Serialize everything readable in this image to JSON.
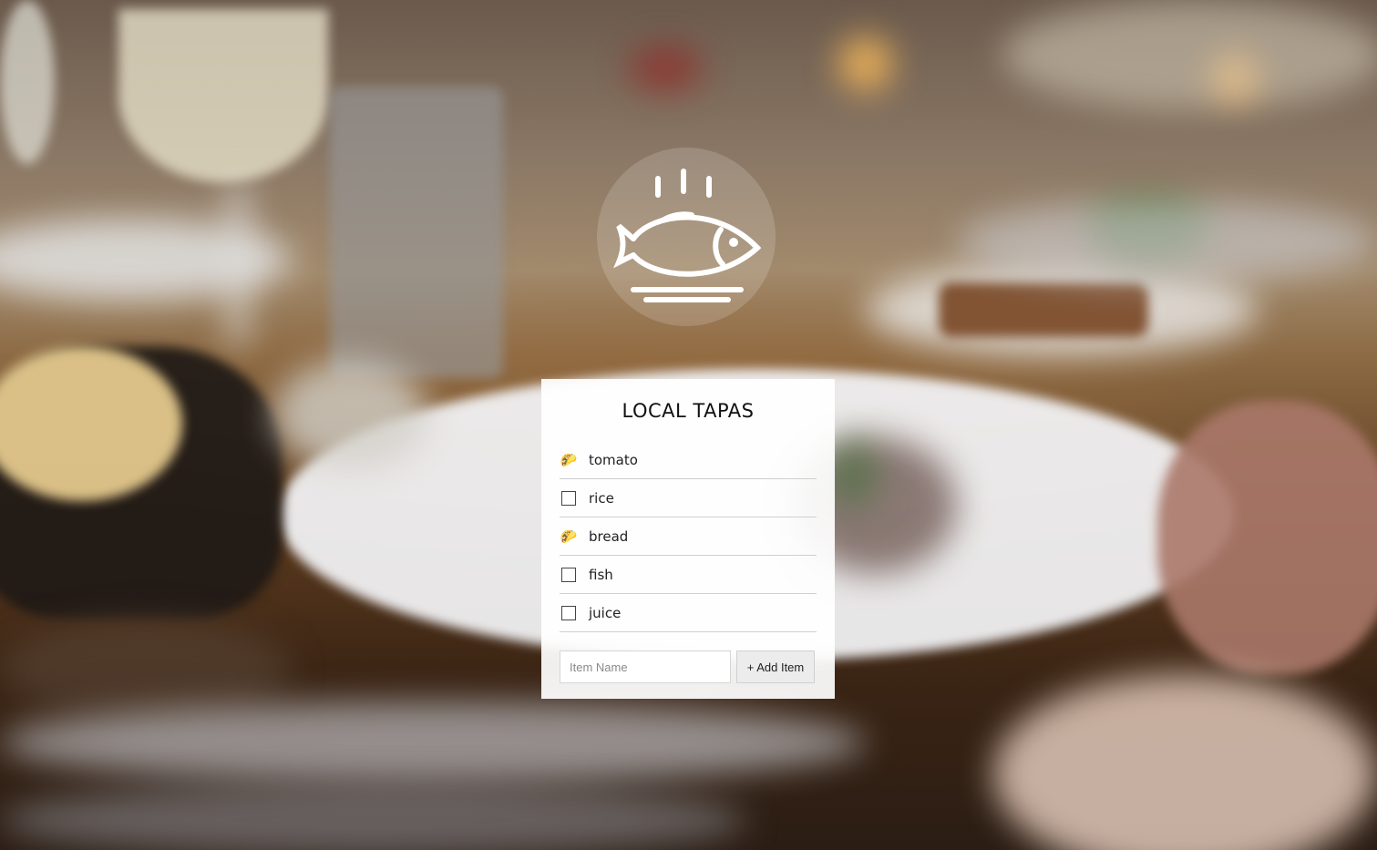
{
  "card": {
    "title": "LOCAL TAPAS",
    "items": [
      {
        "label": "tomato",
        "checked": true,
        "icon": "taco-icon"
      },
      {
        "label": "rice",
        "checked": false,
        "icon": "checkbox"
      },
      {
        "label": "bread",
        "checked": true,
        "icon": "taco-icon"
      },
      {
        "label": "fish",
        "checked": false,
        "icon": "checkbox"
      },
      {
        "label": "juice",
        "checked": false,
        "icon": "checkbox"
      }
    ],
    "input_placeholder": "Item Name",
    "add_button_label": "+ Add Item"
  },
  "logo": {
    "icon": "steaming-fish-on-plate-icon"
  },
  "colors": {
    "card_bg": "#ffffff",
    "text": "#111111",
    "logo_stroke": "#ffffff"
  }
}
